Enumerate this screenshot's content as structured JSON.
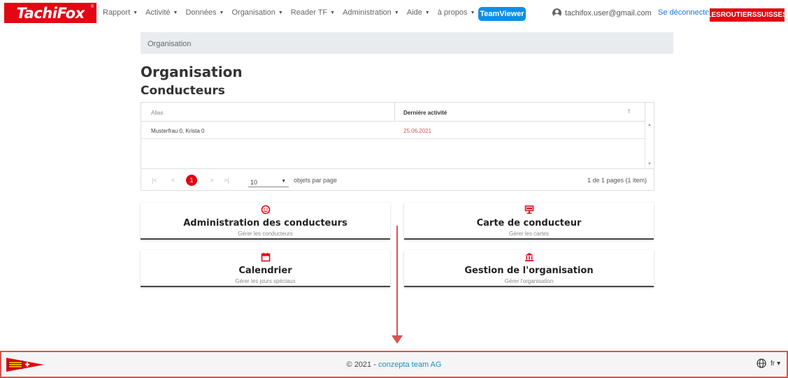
{
  "header": {
    "logo": "TachiFox",
    "logo_mark": "®",
    "nav": [
      {
        "label": "Rapport",
        "caret": "▼"
      },
      {
        "label": "Activité",
        "caret": "▼"
      },
      {
        "label": "Données",
        "caret": "▼"
      },
      {
        "label": "Organisation",
        "caret": "▼"
      },
      {
        "label": "Reader TF",
        "caret": "▼"
      },
      {
        "label": "Administration",
        "caret": "▼"
      },
      {
        "label": "Aide",
        "caret": "▼"
      },
      {
        "label": "à propos",
        "caret": "▼"
      }
    ],
    "teamviewer": "TeamViewer",
    "user_email": "tachifox.user@gmail.com",
    "logout": "Se déconnecter",
    "organization": "LESROUTIERSSUISSES"
  },
  "breadcrumb": "Organisation",
  "page_title": "Organisation",
  "section_title": "Conducteurs",
  "grid": {
    "columns": [
      "Alias",
      "Dernière activité"
    ],
    "sort_glyph": "↑",
    "rows": [
      {
        "alias": "Musterfrau 0, Krista 0",
        "last_activity": "25.06.2021"
      }
    ],
    "pager": {
      "first": "|<",
      "prev": "<",
      "current_page": "1",
      "next": ">",
      "last": ">|",
      "page_size": "10",
      "page_size_caret": "▼",
      "page_size_label": "objets par page",
      "info": "1 de 1 pages (1 item)"
    }
  },
  "cards": [
    {
      "title": "Administration des conducteurs",
      "subtitle": "Gérer les conducteurs",
      "icon": "smiley-icon"
    },
    {
      "title": "Carte de conducteur",
      "subtitle": "Gérer les cartes",
      "icon": "card-reader-icon"
    },
    {
      "title": "Calendrier",
      "subtitle": "Gérer les jours spéciaux",
      "icon": "calendar-icon"
    },
    {
      "title": "Gestion de l'organisation",
      "subtitle": "Gérer l'organisation",
      "icon": "bank-icon"
    }
  ],
  "footer": {
    "copyright_prefix": "© 2021 - ",
    "company": "conzepta team AG",
    "language": "fr",
    "language_caret": "▾"
  },
  "colors": {
    "brand_red": "#e30613",
    "link_blue": "#1a73e8",
    "teamviewer_blue": "#0e8ee9",
    "annotation_red": "#d9534f"
  }
}
